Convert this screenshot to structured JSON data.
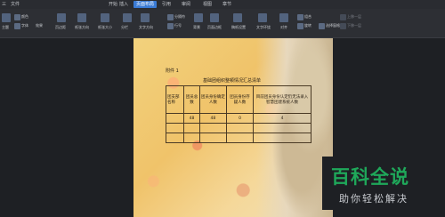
{
  "menubar": {
    "items": [
      "三",
      "文件",
      "开始",
      "插入",
      "页面布局",
      "引用",
      "审阅",
      "视图",
      "章节"
    ],
    "active_tab": "页面布局"
  },
  "ribbon": {
    "theme": "主题",
    "colors": "颜色",
    "fonts": "字体",
    "effects": "效果",
    "margins": "页边距",
    "orientation": "纸张方向",
    "size": "纸张大小",
    "columns": "分栏",
    "text_direction": "文字方向",
    "separator": "分隔符",
    "line_number": "行号",
    "background": "背景",
    "page_border": "页面边框",
    "draft_settings": "稿纸设置",
    "text_wrap": "文字环绕",
    "align": "对齐",
    "group": "组合",
    "rotate": "旋转",
    "select_pane": "选择窗格",
    "bring_forward": "上移一层",
    "send_backward": "下移一层"
  },
  "document": {
    "attachment": "附件 1",
    "title": "基础团组织整顿情况汇总清单",
    "table": {
      "rows": [
        [
          "团支部名称",
          "团员总数",
          "团员身份确定人数",
          "团员身份存疑人数",
          "目前团员身份认定仍无法录入智慧团建系统人数"
        ],
        [
          "",
          "48",
          "48",
          "0",
          "4"
        ],
        [
          "",
          "",
          "",
          "",
          ""
        ],
        [
          "",
          "",
          "",
          "",
          ""
        ]
      ]
    }
  },
  "watermark": {
    "main": "百科全说",
    "sub": "助你轻松解决"
  }
}
